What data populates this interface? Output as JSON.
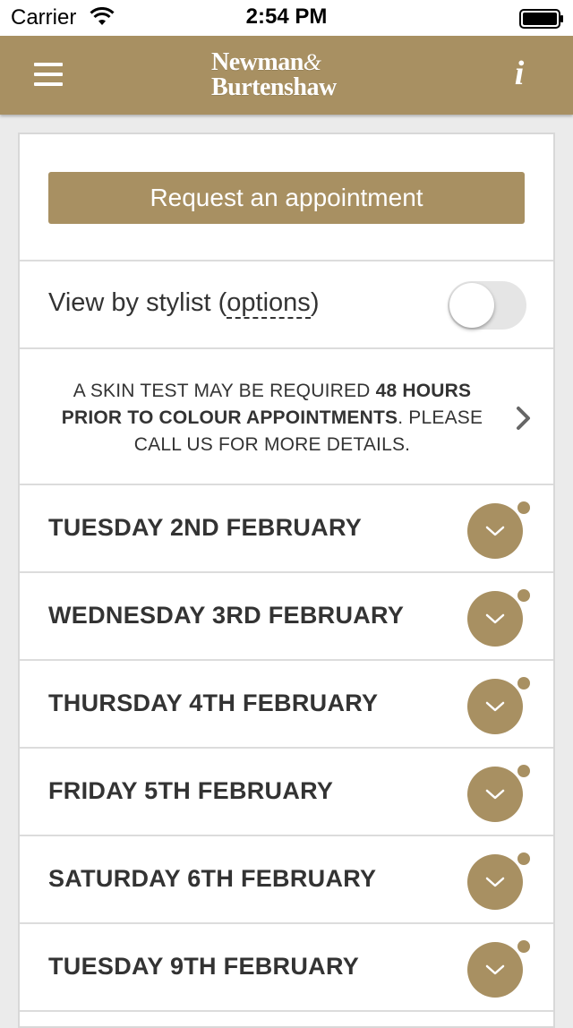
{
  "status_bar": {
    "carrier": "Carrier",
    "time": "2:54 PM",
    "wifi_icon": "wifi-icon",
    "battery_icon": "battery-icon"
  },
  "nav": {
    "menu_icon": "hamburger-menu-icon",
    "logo_line1": "Newman",
    "logo_amp": "&",
    "logo_line2": "Burtenshaw",
    "info_label": "i",
    "brand_color": "#a89062"
  },
  "request_button": "Request an appointment",
  "stylist": {
    "label": "View by stylist (",
    "options": "options",
    "close": ")",
    "toggle_on": false
  },
  "notice": {
    "part1": "A SKIN TEST MAY BE REQUIRED ",
    "bold": "48 HOURS PRIOR TO COLOUR APPOINTMENTS",
    "part2": ". PLEASE CALL US FOR MORE DETAILS.",
    "icon": "chevron-right-icon"
  },
  "days": [
    {
      "label": "TUESDAY 2ND FEBRUARY"
    },
    {
      "label": "WEDNESDAY 3RD FEBRUARY"
    },
    {
      "label": "THURSDAY 4TH FEBRUARY"
    },
    {
      "label": "FRIDAY 5TH FEBRUARY"
    },
    {
      "label": "SATURDAY 6TH FEBRUARY"
    },
    {
      "label": "TUESDAY 9TH FEBRUARY"
    }
  ]
}
